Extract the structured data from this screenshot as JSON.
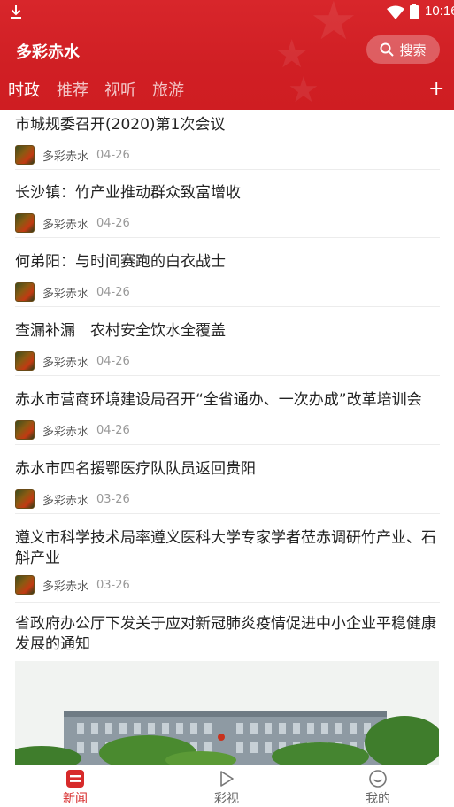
{
  "status_bar": {
    "time": "10:16"
  },
  "header": {
    "app_title": "多彩赤水",
    "search_label": "搜索"
  },
  "tabs": [
    {
      "label": "时政",
      "active": true
    },
    {
      "label": "推荐",
      "active": false
    },
    {
      "label": "视听",
      "active": false
    },
    {
      "label": "旅游",
      "active": false
    }
  ],
  "news": [
    {
      "title": "市城规委召开(2020)第1次会议",
      "source": "多彩赤水",
      "date": "04-26"
    },
    {
      "title": "长沙镇：竹产业推动群众致富增收",
      "source": "多彩赤水",
      "date": "04-26"
    },
    {
      "title": "何弟阳：与时间赛跑的白衣战士",
      "source": "多彩赤水",
      "date": "04-26"
    },
    {
      "title": "查漏补漏　农村安全饮水全覆盖",
      "source": "多彩赤水",
      "date": "04-26"
    },
    {
      "title": "赤水市营商环境建设局召开“全省通办、一次办成”改革培训会",
      "source": "多彩赤水",
      "date": "04-26"
    },
    {
      "title": "赤水市四名援鄂医疗队队员返回贵阳",
      "source": "多彩赤水",
      "date": "03-26"
    },
    {
      "title": "遵义市科学技术局率遵义医科大学专家学者莅赤调研竹产业、石斛产业",
      "source": "多彩赤水",
      "date": "03-26"
    },
    {
      "title": "省政府办公厅下发关于应对新冠肺炎疫情促进中小企业平稳健康发展的通知"
    }
  ],
  "bottom_nav": [
    {
      "label": "新闻",
      "active": true,
      "icon": "news-icon"
    },
    {
      "label": "彩视",
      "active": false,
      "icon": "play-icon"
    },
    {
      "label": "我的",
      "active": false,
      "icon": "profile-icon"
    }
  ],
  "colors": {
    "brand_red": "#d01f24",
    "accent_red": "#d72a2a"
  }
}
